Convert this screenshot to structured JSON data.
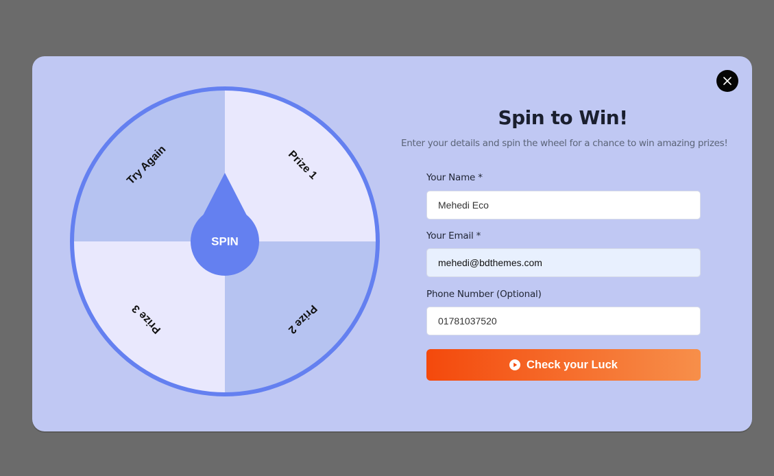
{
  "modal": {
    "close_icon": "close-icon",
    "wheel": {
      "segments": [
        {
          "label": "Try Again",
          "color": "#b6c3f1"
        },
        {
          "label": "Prize 1",
          "color": "#e9e8fd"
        },
        {
          "label": "Prize 2",
          "color": "#b6c3f1"
        },
        {
          "label": "Prize 3",
          "color": "#e9e8fd"
        }
      ],
      "rim_color": "#6480f0",
      "spin_label": "SPIN"
    },
    "title": "Spin to Win!",
    "subtitle": "Enter your details and spin the wheel for a chance to win amazing prizes!",
    "form": {
      "name": {
        "label": "Your Name *",
        "value": "Mehedi Eco"
      },
      "email": {
        "label": "Your Email *",
        "value": "mehedi@bdthemes.com"
      },
      "phone": {
        "label": "Phone Number (Optional)",
        "value": "01781037520"
      },
      "submit": {
        "label": "Check your Luck",
        "icon": "play-circle-icon"
      }
    }
  }
}
